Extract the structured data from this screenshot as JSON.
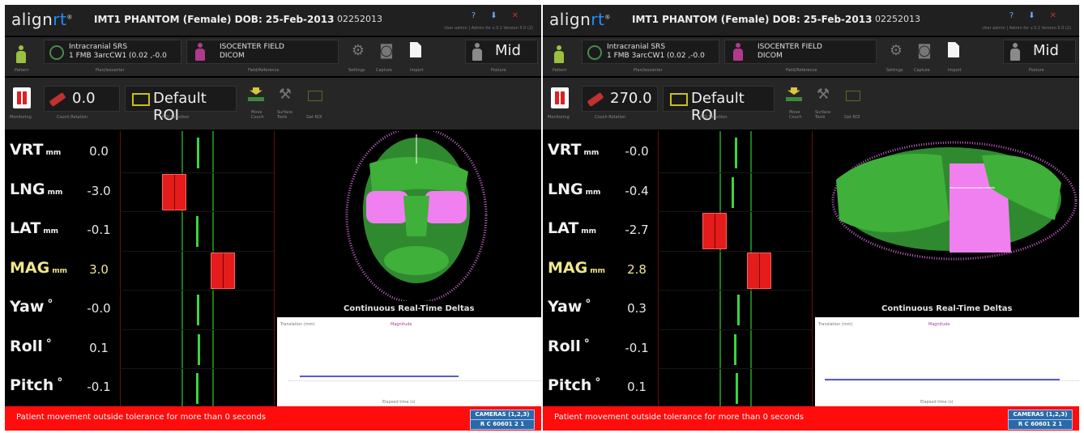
{
  "colors": {
    "status_red": "#ff0d0d",
    "accent_blue": "#1e90ff",
    "bar_red": "#e51c1c",
    "green": "#3cd43c",
    "magenta": "#f07ff0",
    "surface_green": "#3fb03a"
  },
  "panels": [
    {
      "logo": {
        "main": "align",
        "accent": "rt"
      },
      "patient_line": "IMT1 PHANTOM (Female) DOB: 25-Feb-2013",
      "patient_id": "02252013",
      "top_small": "User admin | Admin for v.3.1     Version 5.0 (2)",
      "patient_btn_label": "Patient",
      "plan": {
        "line1": "Intracranial SRS",
        "line2": "1 FMB 3arcCW1  (0.02 ,-0.0",
        "sub": "Plan/Isocenter"
      },
      "field": {
        "line1": "ISOCENTER FIELD",
        "line2": "DICOM",
        "sub": "Field/Reference"
      },
      "tools": {
        "settings": "Settings",
        "capture": "Capture",
        "import": "Import"
      },
      "posture": {
        "value": "Mid",
        "sub": "Posture"
      },
      "monitoring_label": "Monitoring",
      "couch": {
        "value": "0.0",
        "sub": "Couch Rotation"
      },
      "roi": {
        "value": "Default ROI",
        "sub": "ROI Selection"
      },
      "tools2": {
        "move": "Move Couch",
        "surface": "Surface Tools",
        "get_roi": "Get ROI"
      },
      "deltas": [
        {
          "name": "VRT",
          "unit": "mm",
          "value": "0.0",
          "bar": 0.0
        },
        {
          "name": "LNG",
          "unit": "mm",
          "value": "-3.0",
          "bar": -3.0
        },
        {
          "name": "LAT",
          "unit": "mm",
          "value": "-0.1",
          "bar": -0.1
        },
        {
          "name": "MAG",
          "unit": "mm",
          "value": "3.0",
          "bar": 3.0,
          "highlight": true
        },
        {
          "name": "Yaw",
          "unit": "°",
          "value": "-0.0",
          "bar": 0.0
        },
        {
          "name": "Roll",
          "unit": "°",
          "value": "0.1",
          "bar": 0.1
        },
        {
          "name": "Pitch",
          "unit": "°",
          "value": "-0.1",
          "bar": -0.1
        }
      ],
      "view_title": "Continuous Real-Time Deltas",
      "plot": {
        "ylabel": "Translation (mm)",
        "legend": "Magnitude",
        "xlabel": "Elapsed time (s)"
      },
      "status_message": "Patient movement outside tolerance for more than 0 seconds",
      "cameras": {
        "line1": "CAMERAS (1,2,3)",
        "line2": "R C 60601  2  1"
      }
    },
    {
      "logo": {
        "main": "align",
        "accent": "rt"
      },
      "patient_line": "IMT1 PHANTOM (Female) DOB: 25-Feb-2013",
      "patient_id": "02252013",
      "top_small": "User admin | Admin for v.3.1     Version 5.0 (2)",
      "patient_btn_label": "Patient",
      "plan": {
        "line1": "Intracranial SRS",
        "line2": "1 FMB 3arcCW1  (0.02 ,-0.0",
        "sub": "Plan/Isocenter"
      },
      "field": {
        "line1": "ISOCENTER FIELD",
        "line2": "DICOM",
        "sub": "Field/Reference"
      },
      "tools": {
        "settings": "Settings",
        "capture": "Capture",
        "import": "Import"
      },
      "posture": {
        "value": "Mid",
        "sub": "Posture"
      },
      "monitoring_label": "Monitoring",
      "couch": {
        "value": "270.0",
        "sub": "Couch Rotation"
      },
      "roi": {
        "value": "Default ROI",
        "sub": "ROI Selection"
      },
      "tools2": {
        "move": "Move Couch",
        "surface": "Surface Tools",
        "get_roi": "Get ROI"
      },
      "deltas": [
        {
          "name": "VRT",
          "unit": "mm",
          "value": "-0.0",
          "bar": 0.0
        },
        {
          "name": "LNG",
          "unit": "mm",
          "value": "-0.4",
          "bar": -0.4
        },
        {
          "name": "LAT",
          "unit": "mm",
          "value": "-2.7",
          "bar": -2.7
        },
        {
          "name": "MAG",
          "unit": "mm",
          "value": "2.8",
          "bar": 2.8,
          "highlight": true
        },
        {
          "name": "Yaw",
          "unit": "°",
          "value": "0.3",
          "bar": 0.3
        },
        {
          "name": "Roll",
          "unit": "°",
          "value": "-0.1",
          "bar": -0.1
        },
        {
          "name": "Pitch",
          "unit": "°",
          "value": "0.1",
          "bar": 0.1
        }
      ],
      "view_title": "Continuous Real-Time Deltas",
      "plot": {
        "ylabel": "Translation (mm)",
        "legend": "Magnitude",
        "xlabel": "Elapsed time (s)"
      },
      "status_message": "Patient movement outside tolerance for more than 0 seconds",
      "cameras": {
        "line1": "CAMERAS (1,2,3)",
        "line2": "R C 60601  2  1"
      }
    }
  ]
}
